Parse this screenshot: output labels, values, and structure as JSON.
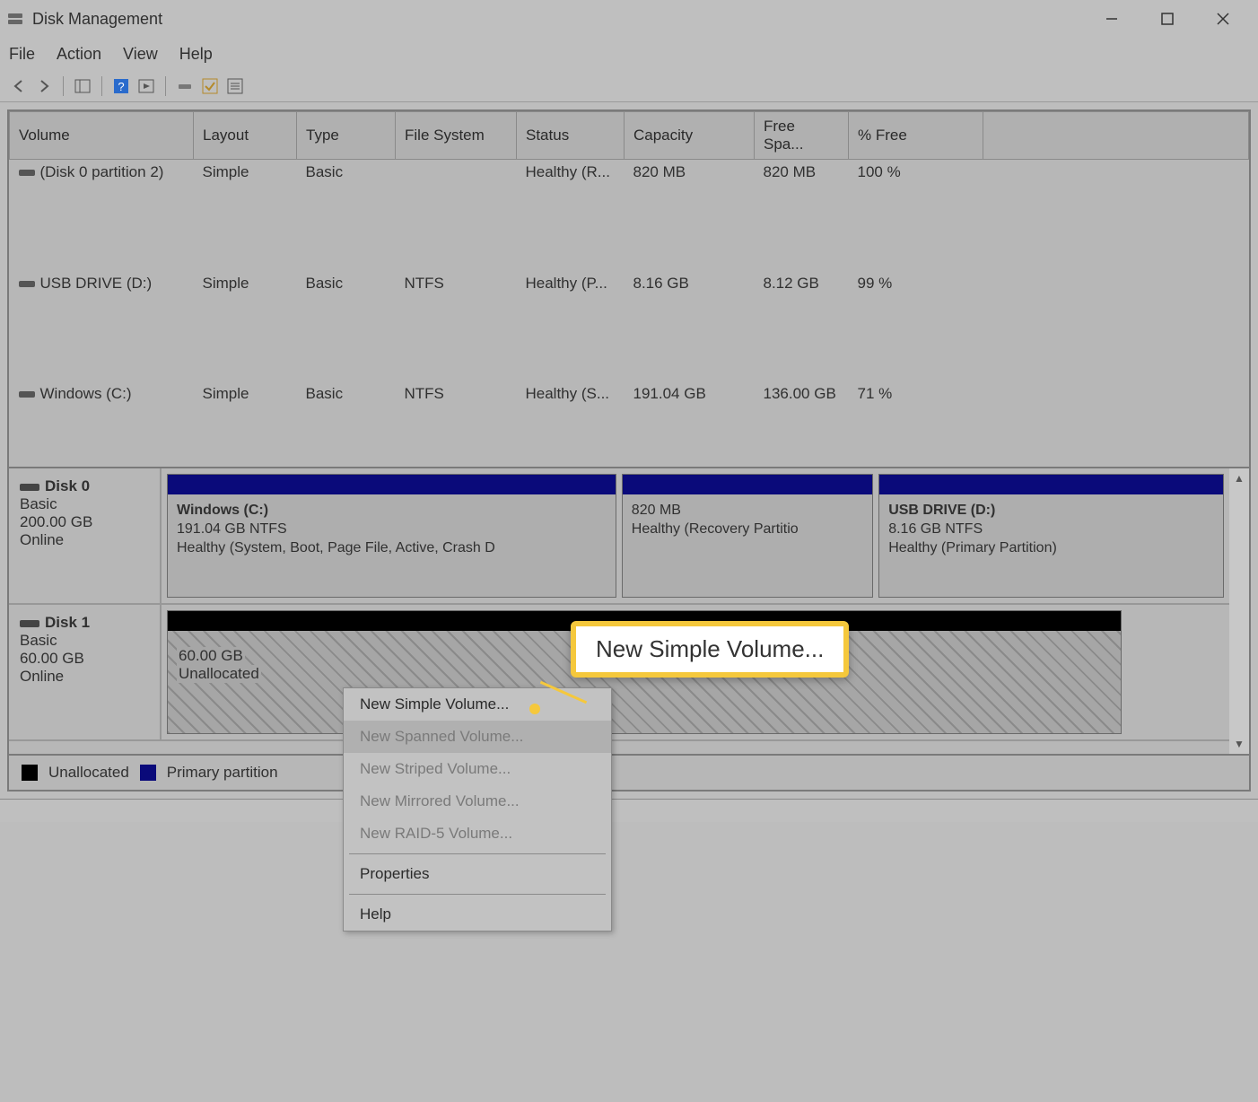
{
  "titlebar": {
    "title": "Disk Management"
  },
  "menu": {
    "file": "File",
    "action": "Action",
    "view": "View",
    "help": "Help"
  },
  "vol_headers": {
    "volume": "Volume",
    "layout": "Layout",
    "type": "Type",
    "fs": "File System",
    "status": "Status",
    "capacity": "Capacity",
    "free": "Free Spa...",
    "pct": "% Free"
  },
  "vols": [
    {
      "name": "(Disk 0 partition 2)",
      "layout": "Simple",
      "type": "Basic",
      "fs": "",
      "status": "Healthy (R...",
      "cap": "820 MB",
      "free": "820 MB",
      "pct": "100 %"
    },
    {
      "name": "USB DRIVE (D:)",
      "layout": "Simple",
      "type": "Basic",
      "fs": "NTFS",
      "status": "Healthy (P...",
      "cap": "8.16 GB",
      "free": "8.12 GB",
      "pct": "99 %"
    },
    {
      "name": "Windows (C:)",
      "layout": "Simple",
      "type": "Basic",
      "fs": "NTFS",
      "status": "Healthy (S...",
      "cap": "191.04 GB",
      "free": "136.00 GB",
      "pct": "71 %"
    }
  ],
  "disks": [
    {
      "name": "Disk 0",
      "type": "Basic",
      "size": "200.00 GB",
      "state": "Online",
      "parts": [
        {
          "name": "Windows  (C:)",
          "sub": "191.04 GB NTFS",
          "health": "Healthy (System, Boot, Page File, Active, Crash D",
          "flex": 43,
          "bar": "blue"
        },
        {
          "name": "",
          "sub": "820 MB",
          "health": "Healthy (Recovery Partitio",
          "flex": 24,
          "bar": "blue"
        },
        {
          "name": "USB DRIVE  (D:)",
          "sub": "8.16 GB NTFS",
          "health": "Healthy (Primary Partition)",
          "flex": 33,
          "bar": "blue"
        }
      ]
    },
    {
      "name": "Disk 1",
      "type": "Basic",
      "size": "60.00 GB",
      "state": "Online",
      "unallocated": {
        "size": "60.00 GB",
        "label": "Unallocated"
      }
    }
  ],
  "legend": {
    "unalloc": "Unallocated",
    "primary": "Primary partition"
  },
  "context_menu": {
    "items": [
      {
        "label": "New Simple Volume...",
        "enabled": true
      },
      {
        "label": "New Spanned Volume...",
        "enabled": false
      },
      {
        "label": "New Striped Volume...",
        "enabled": false
      },
      {
        "label": "New Mirrored Volume...",
        "enabled": false
      },
      {
        "label": "New RAID-5 Volume...",
        "enabled": false
      }
    ],
    "sep_then": [
      {
        "label": "Properties",
        "enabled": true
      },
      {
        "label": "Help",
        "enabled": true
      }
    ]
  },
  "callout": {
    "text": "New Simple Volume..."
  }
}
